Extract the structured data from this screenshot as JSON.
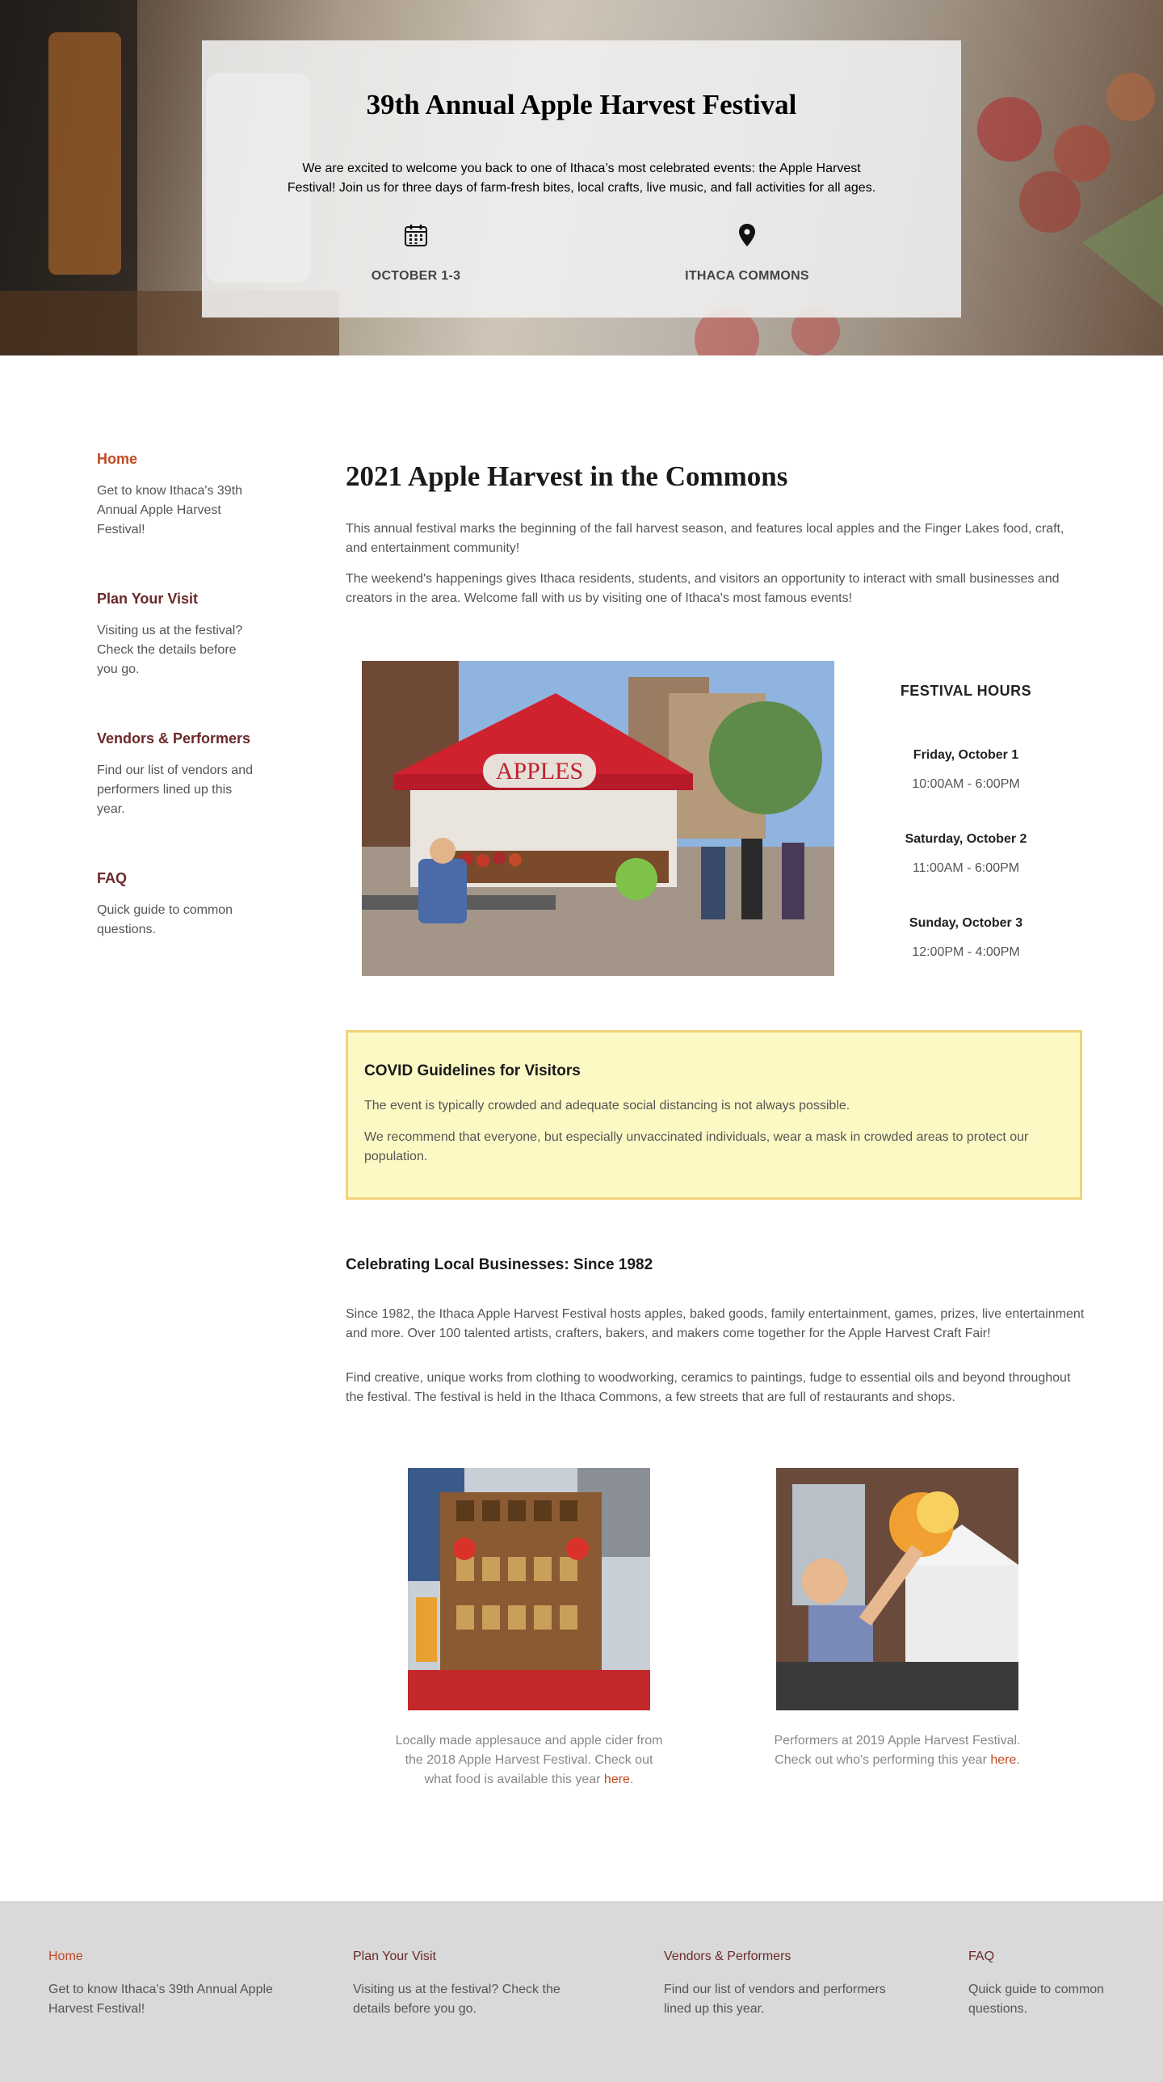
{
  "hero": {
    "title": "39th Annual Apple Harvest Festival",
    "intro": "We are excited to welcome you back to one of Ithaca’s most celebrated events: the Apple Harvest Festival! Join us for three days of farm-fresh bites, local crafts, live music, and fall activities for all ages.",
    "date_label": "OCTOBER 1-3",
    "location_label": "ITHACA COMMONS",
    "date_icon": "calendar-icon",
    "location_icon": "map-pin-icon"
  },
  "sidebar": {
    "items": [
      {
        "title": "Home",
        "desc": "Get to know Ithaca's 39th Annual Apple Harvest Festival!",
        "active": true
      },
      {
        "title": "Plan Your Visit",
        "desc": "Visiting us at the festival? Check the details before you go.",
        "active": false
      },
      {
        "title": "Vendors & Performers",
        "desc": "Find our list of vendors and performers lined up this year.",
        "active": false
      },
      {
        "title": "FAQ",
        "desc": "Quick guide to common questions.",
        "active": false
      }
    ]
  },
  "main": {
    "title": "2021 Apple Harvest in the Commons",
    "para1": "This annual festival marks the beginning of the fall harvest season, and features local apples and the Finger Lakes food, craft, and entertainment community!",
    "para2": "The weekend's happenings gives Ithaca residents, students, and visitors an opportunity to interact with small businesses and creators in the area. Welcome fall with us by visiting one of Ithaca's most famous events!",
    "featured_sign": "APPLES"
  },
  "hours": {
    "title": "FESTIVAL HOURS",
    "days": [
      {
        "day": "Friday, October 1",
        "time": "10:00AM - 6:00PM"
      },
      {
        "day": "Saturday, October 2",
        "time": "11:00AM - 6:00PM"
      },
      {
        "day": "Sunday, October 3",
        "time": "12:00PM - 4:00PM"
      }
    ]
  },
  "covid": {
    "title": "COVID Guidelines for Visitors",
    "p1": "The event is typically crowded and adequate social distancing is not always possible.",
    "p2": "We recommend that everyone, but especially unvaccinated individuals, wear a mask in crowded areas to protect our population."
  },
  "local": {
    "title": "Celebrating Local Businesses: Since 1982",
    "p1": "Since 1982, the Ithaca Apple Harvest Festival hosts apples, baked goods, family entertainment, games, prizes, live entertainment and more. Over 100 talented artists, crafters, bakers, and makers come together for the Apple Harvest Craft Fair!",
    "p2": "Find creative, unique works from clothing to woodworking, ceramics to paintings, fudge to essential oils and beyond throughout the festival. The festival is held in the Ithaca Commons, a few streets that are full of restaurants and shops."
  },
  "figures": {
    "food": {
      "caption": "Locally made applesauce and apple cider from the 2018 Apple Harvest Festival. Check out what food is available this year ",
      "link": "here",
      "end": "."
    },
    "performers": {
      "caption": "Performers at 2019 Apple Harvest Festival. Check out who's performing this year ",
      "link": "here",
      "end": "."
    }
  },
  "footer": {
    "cols": [
      {
        "title": "Home",
        "desc": "Get to know Ithaca's 39th Annual Apple Harvest Festival!",
        "active": true
      },
      {
        "title": "Plan Your Visit",
        "desc": "Visiting us at the festival? Check the details before you go.",
        "active": false
      },
      {
        "title": "Vendors & Performers",
        "desc": "Find our list of vendors and performers lined up this year.",
        "active": false
      },
      {
        "title": "FAQ",
        "desc": "Quick guide to common questions.",
        "active": false
      }
    ]
  },
  "colors": {
    "accent": "#c24a22",
    "nav": "#6b2a2a",
    "covid_bg": "#fdf9c4",
    "covid_border": "#f0d37a",
    "footer_bg": "#d9d9d9"
  }
}
